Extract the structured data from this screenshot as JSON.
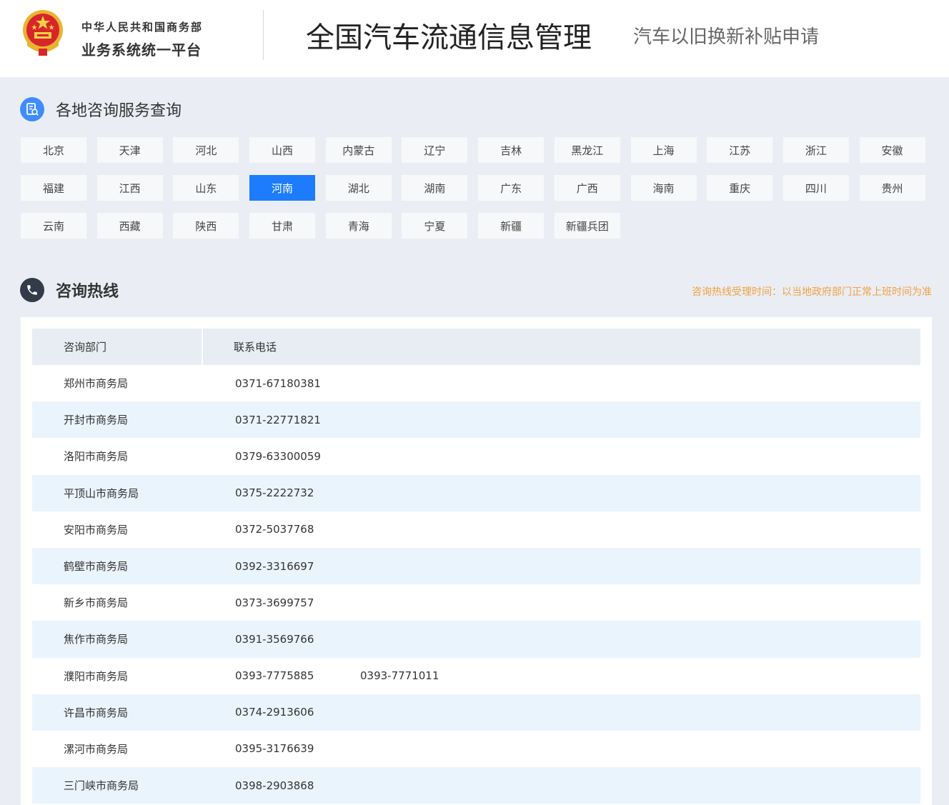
{
  "header": {
    "org_line1": "中华人民共和国商务部",
    "org_line2": "业务系统统一平台",
    "main_title": "全国汽车流通信息管理",
    "sub_title": "汽车以旧换新补贴申请"
  },
  "regions_section": {
    "title": "各地咨询服务查询",
    "selected": "河南",
    "items": [
      "北京",
      "天津",
      "河北",
      "山西",
      "内蒙古",
      "辽宁",
      "吉林",
      "黑龙江",
      "上海",
      "江苏",
      "浙江",
      "安徽",
      "福建",
      "江西",
      "山东",
      "河南",
      "湖北",
      "湖南",
      "广东",
      "广西",
      "海南",
      "重庆",
      "四川",
      "贵州",
      "云南",
      "西藏",
      "陕西",
      "甘肃",
      "青海",
      "宁夏",
      "新疆",
      "新疆兵团"
    ]
  },
  "hotline_section": {
    "title": "咨询热线",
    "note": "咨询热线受理时间：以当地政府部门正常上班时间为准",
    "columns": [
      "咨询部门",
      "联系电话"
    ],
    "rows": [
      {
        "dept": "郑州市商务局",
        "phone": "0371-67180381",
        "phone2": ""
      },
      {
        "dept": "开封市商务局",
        "phone": "0371-22771821",
        "phone2": ""
      },
      {
        "dept": "洛阳市商务局",
        "phone": "0379-63300059",
        "phone2": ""
      },
      {
        "dept": "平顶山市商务局",
        "phone": "0375-2222732",
        "phone2": ""
      },
      {
        "dept": "安阳市商务局",
        "phone": "0372-5037768",
        "phone2": ""
      },
      {
        "dept": "鹤壁市商务局",
        "phone": "0392-3316697",
        "phone2": ""
      },
      {
        "dept": "新乡市商务局",
        "phone": "0373-3699757",
        "phone2": ""
      },
      {
        "dept": "焦作市商务局",
        "phone": "0391-3569766",
        "phone2": ""
      },
      {
        "dept": "濮阳市商务局",
        "phone": "0393-7775885",
        "phone2": "0393-7771011"
      },
      {
        "dept": "许昌市商务局",
        "phone": "0374-2913606",
        "phone2": ""
      },
      {
        "dept": "漯河市商务局",
        "phone": "0395-3176639",
        "phone2": ""
      },
      {
        "dept": "三门峡市商务局",
        "phone": "0398-2903868",
        "phone2": ""
      }
    ]
  },
  "colors": {
    "accent": "#1c7cfb",
    "note": "#f0a040",
    "row_stripe": "#eaf4fc"
  }
}
